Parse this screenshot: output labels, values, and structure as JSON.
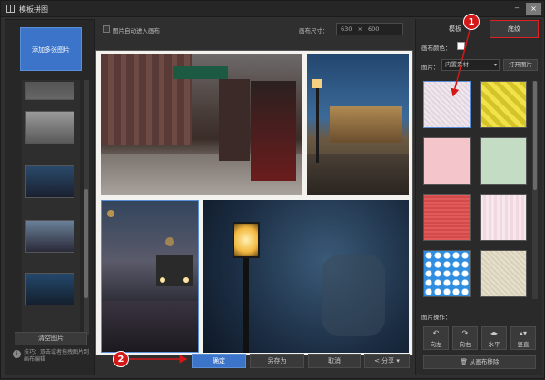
{
  "window": {
    "title": "模板拼图",
    "min_label": "‒",
    "close_label": "×"
  },
  "left": {
    "add_label": "添加多张图片",
    "clear_label": "清空图片",
    "tip_text": "技巧：双击或者拖拽图片到画布编辑"
  },
  "top": {
    "auto_label": "图片自动进入画布",
    "size_label": "画布尺寸：",
    "size_w": "630",
    "size_x": "×",
    "size_h": "600"
  },
  "bottom": {
    "ok_label": "确定",
    "saveas_label": "另存为",
    "cancel_label": "取消",
    "share_label": "分享"
  },
  "right": {
    "tab_template": "模板",
    "tab_texture": "底纹",
    "canvas_color_label": "画布颜色：",
    "pic_label": "图片：",
    "pic_select_value": "内置素材",
    "open_label": "打开图片",
    "ops_label": "图片操作：",
    "ops": [
      "向左",
      "向右",
      "水平",
      "竖直"
    ],
    "remove_label": "从画布移除"
  },
  "badges": {
    "one": "1",
    "two": "2"
  },
  "colors": {
    "accent": "#3b74c8",
    "callout": "#d21818"
  }
}
